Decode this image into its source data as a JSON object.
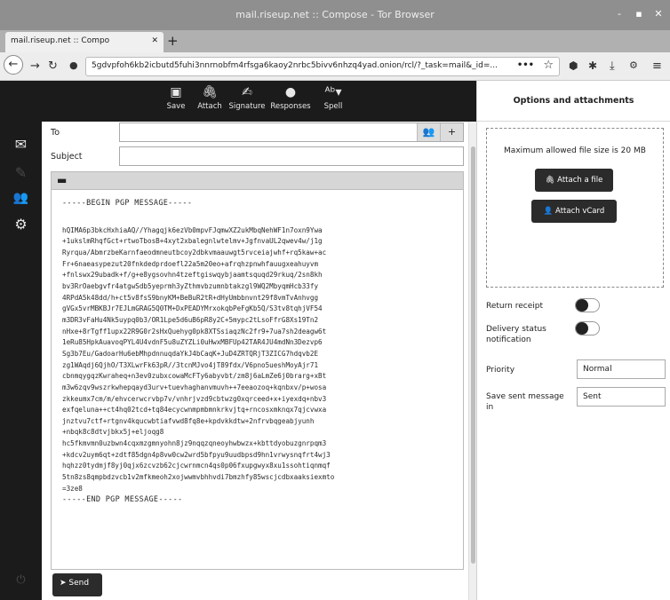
{
  "window": {
    "title": "mail.riseup.net :: Compose - Tor Browser",
    "minimize": "-",
    "maximize": "▪",
    "close": "✕"
  },
  "tab": {
    "label": "mail.riseup.net :: Compo",
    "close": "✕",
    "new": "+"
  },
  "nav": {
    "url": "5gdvpfoh6kb2icbutd5fuhi3nnrnobfm4rfsga6kaoy2nrbc5bivv6nhzq4yad.onion/rcl/?_task=mail&_id=...",
    "more": "•••"
  },
  "toolbar": {
    "save": "Save",
    "attach": "Attach",
    "signature": "Signature",
    "responses": "Responses",
    "spell": "Spell"
  },
  "compose": {
    "to_label": "To",
    "subject_label": "Subject",
    "pgp_begin": "-----BEGIN PGP MESSAGE-----",
    "pgp_lines": [
      "hQIMA6p3bkcHxhiaAQ//Yhagqjk6ezVb0mpvFJqmwXZ2ukMbqNehWF1n7oxn9Ywa",
      "+1ukslmRhqfGct+rtwoTbosB+4xyt2xbalegnlwtelmv+JgfnvaUL2qwev4w/j1g",
      "Ryrqua/AbmrzbeKarnfaeodmneutbcoy2dbkvmaauwgt5rvceiajwhf+rq5kaw+ac",
      "Fr+6naeasypezut20fnkdedprdoefl22a5m20eo+afrqhzpnwhfauugxeahuyvm",
      "+fnlswx29ubadk+f/g+e8ygsovhn4tzeftgiswqybjaamtsquqd29rkuq/2sn8kh",
      "bv3RrOaebgvfr4atgwSdb5yeprmh3yZthmvbzumnbtakzgl9WQ2MbyqmHcb33fy",
      "4RPdA5k48dd/h+ct5v8fsS9bnyKM+BeBuR2tR+dHyUmbbnvnt29f8vmTvAnhvgg",
      "gVGx5vrMBKBJr7EJLmGRAG5Q0TM+DxPEADYMrxokqbPeFgKb5Q/S3tv8tqhjVF54",
      "m3DR3vFaHu4Nk5uypq0b3/OR1Lpe5d6uB6pR8y2C+5mypc2tLsoFfrG8Xs19Tn2",
      "nHxe+8rTgff1upx22R9G0r2sHxQuehyg0pk8XTSsiaqzNc2fr9+7ua7sh2deagw6t",
      "1eRu85HpkAuavoqPYL4U4vdnF5u8uZYZLi0uHwxMBFUp42TAR4JU4mdNn3Dezvp6",
      "Sg3b7Eu/GadoarHu6ebMhpdnnuqdaYkJ4bCaqK+JuD4ZRTQRjT3ZICG7hdqvb2E",
      "zg1WAqdj6QjhO/T3XLwrFk63pR//3tcnMJvo4jT89fdx/V6pno5ueshMoyAjr71",
      "cbnmqygqzKwraheq+n3ev0zubxcowaMcFTy6abyvbt/zm8j6aLmZe6j0brarg+xBt",
      "m3w6zqv9wszrkwhepqayd3urv+tuevhaghanvmuvh++7eeaozoq+kqnbxv/p+wosa",
      "zkkeumx7cm/m/ehvcerwcrvbp7v/vnhrjvzd9cbtwzg0xqrceed+x+iyexdq+nbv3",
      "exfqeluna++ct4hq02tcd+tq84ecycwnmpmbmnkrkvjtq+rncosxmknqx7qjcvwxa",
      "jnztvu7ctf+rtgnv4kqucwbtiafvwd8fq8e+kpdvkkdtw+2nfrvbqgeabjyunh",
      "+nbqk8c8dtvjbkx5j+eljoqg8",
      "hc5fkmvmn0uzbwn4cqxmzgmnyohn8jz9nqqzqneoyhwbwzx+kbttdyobuzgnrpqm3",
      "+kdcv2uym6qt+zdtf85dgn4p8vw0cw2wrd5bfpyu9uudbpsd9hn1vrwysnqfrt4wj3",
      "hqhzz0tydmjf8yj0qjx6zcvzb62cjcwrnmcn4qs0p06fxupgwyx8xu1ssohtiqnmqf",
      "5tn8zs8qmpbdzvcb1v2mfkmeoh2xojwwmvbhhvdi7bmzhfy85wscjcdbxaaksiexmto",
      "=3ze8"
    ],
    "pgp_end": "-----END PGP MESSAGE-----",
    "send": "Send"
  },
  "panel": {
    "title": "Options and attachments",
    "max_size": "Maximum allowed file size is 20 MB",
    "attach_file": "Attach a file",
    "attach_vcard": "Attach vCard",
    "return_receipt": "Return receipt",
    "delivery_notification": "Delivery status notification",
    "priority_label": "Priority",
    "priority_value": "Normal",
    "save_sent_label": "Save sent message in",
    "save_sent_value": "Sent"
  }
}
